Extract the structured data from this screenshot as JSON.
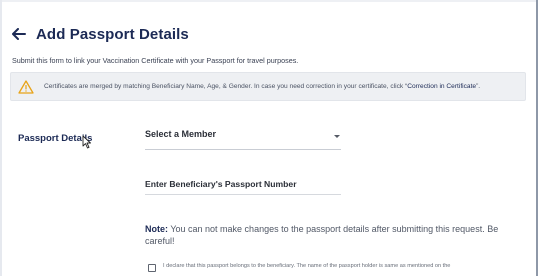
{
  "header": {
    "back_icon": "arrow-left-icon",
    "title": "Add Passport Details"
  },
  "subtitle": "Submit this form to link your Vaccination Certificate with your Passport for travel purposes.",
  "alert": {
    "icon": "warning-icon",
    "text": "Certificates are merged by matching Beneficiary Name, Age, & Gender. In case you need correction in your certificate, click “",
    "link": "Correction in Certificate",
    "suffix": "”."
  },
  "form": {
    "section_label": "Passport Details",
    "member_select": {
      "value": "Select a Member",
      "icon": "chevron-down-icon"
    },
    "passport_input": {
      "placeholder": "Enter Beneficiary's Passport Number",
      "value": ""
    }
  },
  "note": {
    "label": "Note:",
    "text": " You can not make changes to the passport details after submitting this request. Be careful!"
  },
  "declaration": {
    "checked": false,
    "text": "I declare that this passport belongs to the beneficiary. The name of the passport holder is same as mentioned on the"
  },
  "colors": {
    "title": "#1c2a55",
    "warning": "#e8a317",
    "alert_bg": "#eef0f3"
  }
}
